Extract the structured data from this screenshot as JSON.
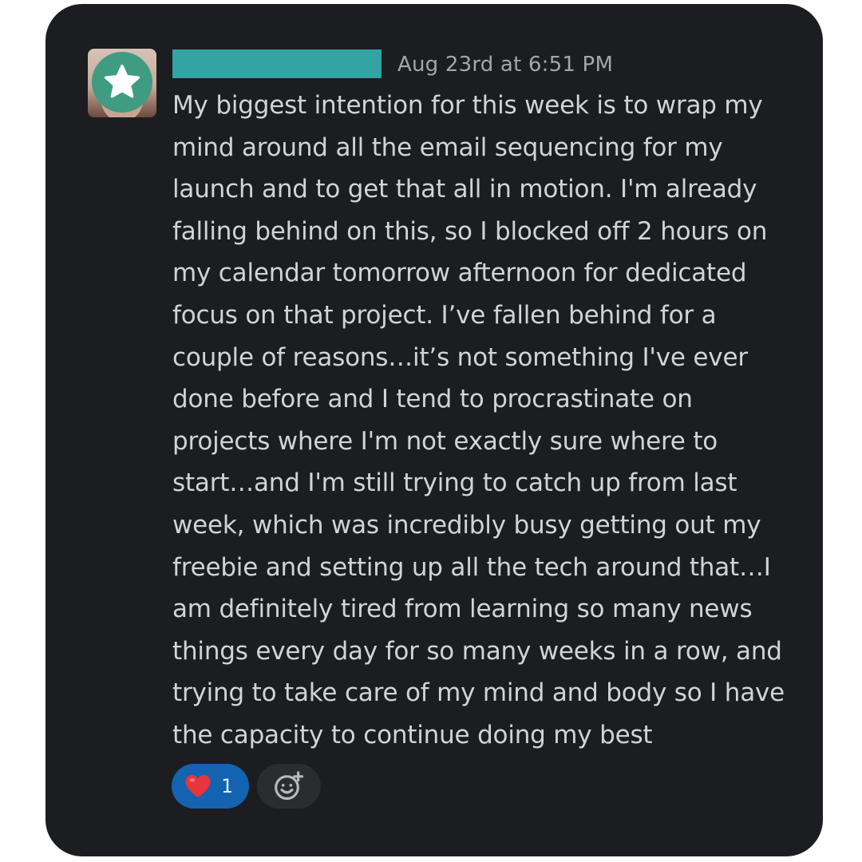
{
  "message": {
    "author_name": "",
    "timestamp": "Aug 23rd at 6:51 PM",
    "lines": [
      "My biggest intention for this week is to wrap my",
      "mind around all the email sequencing for my",
      "launch and to get that all in motion. I'm already",
      "falling behind on this, so I blocked off 2 hours on",
      "my calendar tomorrow afternoon for dedicated",
      "focus on that project. I’ve fallen behind for a",
      "couple of reasons…it’s not something I've ever",
      "done before and I tend to procrastinate on",
      "projects where I'm not exactly sure where to",
      "start…and I'm still trying to catch up from last",
      "week, which was incredibly busy getting out my",
      "freebie and setting up all the tech around that…I",
      "am definitely tired from learning so many news",
      "things every day for so many weeks in a row, and",
      "trying to take care of my mind and body so I have",
      "the capacity to continue doing my best"
    ]
  },
  "reactions": [
    {
      "emoji": "heart-emoji",
      "count": "1",
      "color": "#1363b0"
    }
  ],
  "icons": {
    "avatar_badge": "star-icon",
    "add_reaction": "add-emoji-icon"
  },
  "colors": {
    "background": "#1b1d21",
    "name_redaction": "#33a3a3",
    "text": "#d2d3d5",
    "timestamp": "#a4a6aa"
  }
}
